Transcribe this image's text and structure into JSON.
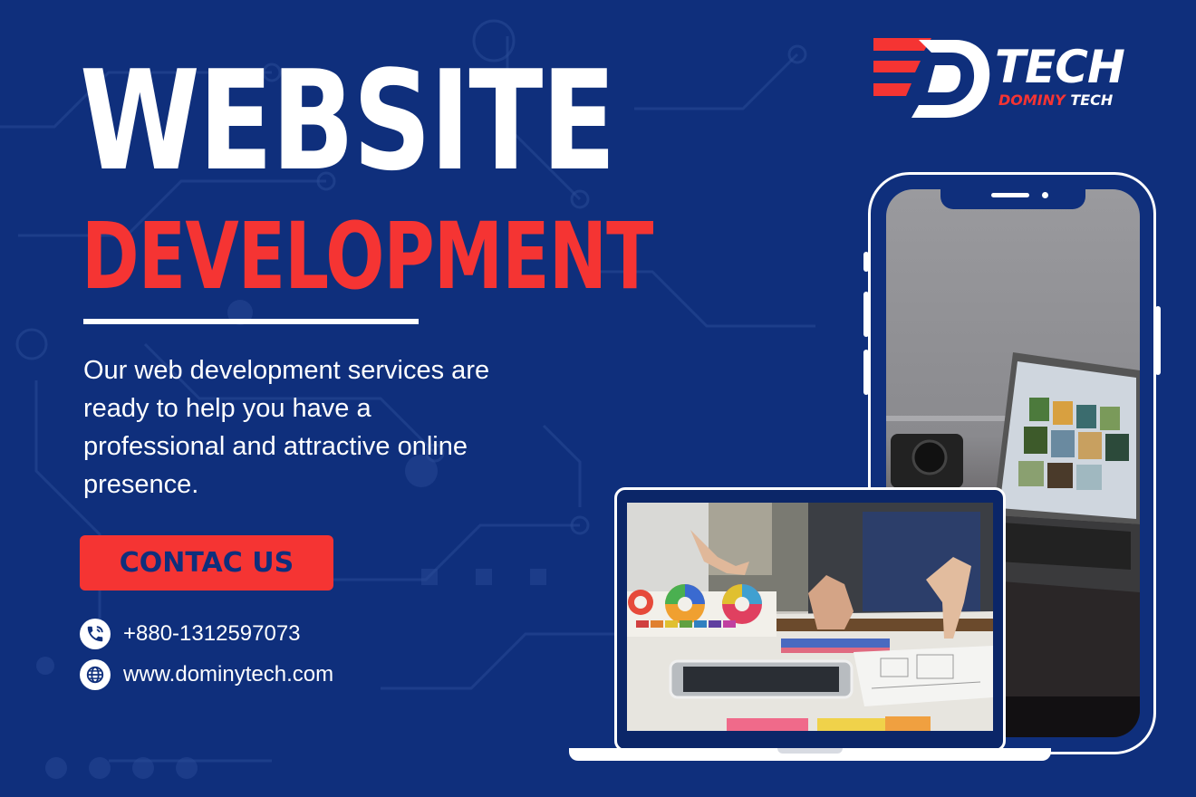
{
  "headline": {
    "line1": "WEBSITE",
    "line2": "DEVELOPMENT"
  },
  "description": "Our web development services are ready to help you have a professional and attractive online presence.",
  "cta": {
    "label": "CONTAC US"
  },
  "contact": {
    "phone": "+880-1312597073",
    "website": "www.dominytech.com"
  },
  "logo": {
    "word": "TECH",
    "sub_red": "DOMINY",
    "sub_white": "TECH"
  },
  "icons": {
    "phone": "phone-call-icon",
    "web": "globe-icon"
  },
  "colors": {
    "background": "#0f2f7c",
    "accent_red": "#f53433",
    "white": "#ffffff"
  }
}
